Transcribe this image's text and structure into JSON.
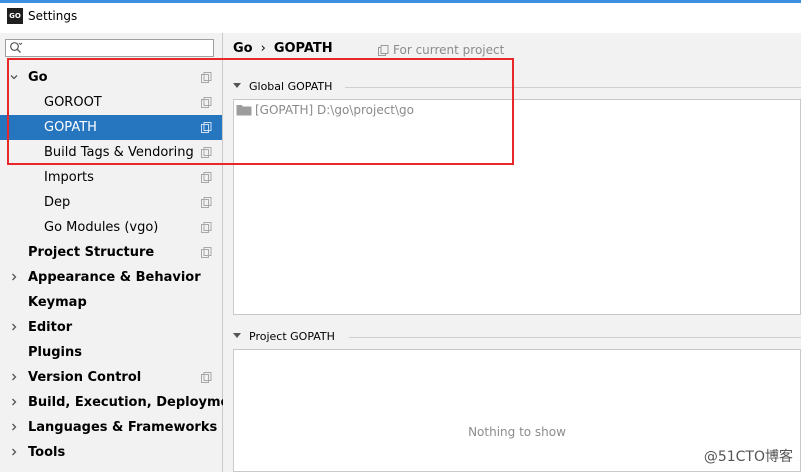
{
  "window": {
    "title": "Settings",
    "app_icon_text": "GO"
  },
  "search": {
    "value": ""
  },
  "tree": [
    {
      "label": "Go",
      "bold": true,
      "expanded": true,
      "chevron": "chevron-down"
    },
    {
      "label": "GOROOT"
    },
    {
      "label": "GOPATH",
      "selected": true
    },
    {
      "label": "Build Tags & Vendoring"
    },
    {
      "label": "Imports"
    },
    {
      "label": "Dep"
    },
    {
      "label": "Go Modules (vgo)"
    },
    {
      "label": "Project Structure",
      "bold": true
    },
    {
      "label": "Appearance & Behavior",
      "bold": true,
      "chevron": "chevron-right"
    },
    {
      "label": "Keymap",
      "bold": true
    },
    {
      "label": "Editor",
      "bold": true,
      "chevron": "chevron-right"
    },
    {
      "label": "Plugins",
      "bold": true
    },
    {
      "label": "Version Control",
      "bold": true,
      "chevron": "chevron-right"
    },
    {
      "label": "Build, Execution, Deployment",
      "bold": true,
      "chevron": "chevron-right"
    },
    {
      "label": "Languages & Frameworks",
      "bold": true,
      "chevron": "chevron-right"
    },
    {
      "label": "Tools",
      "bold": true,
      "chevron": "chevron-right"
    }
  ],
  "breadcrumb": {
    "parent": "Go",
    "separator": "›",
    "current": "GOPATH"
  },
  "scope_note": "For current project",
  "global_gopath": {
    "title": "Global GOPATH",
    "entries": [
      "[GOPATH] D:\\go\\project\\go"
    ]
  },
  "project_gopath": {
    "title": "Project GOPATH",
    "empty_text": "Nothing to show"
  },
  "watermark": "@51CTO博客",
  "colors": {
    "selection": "#2675bf",
    "highlight_box": "#e8272b",
    "topline": "#3c8ee0"
  }
}
